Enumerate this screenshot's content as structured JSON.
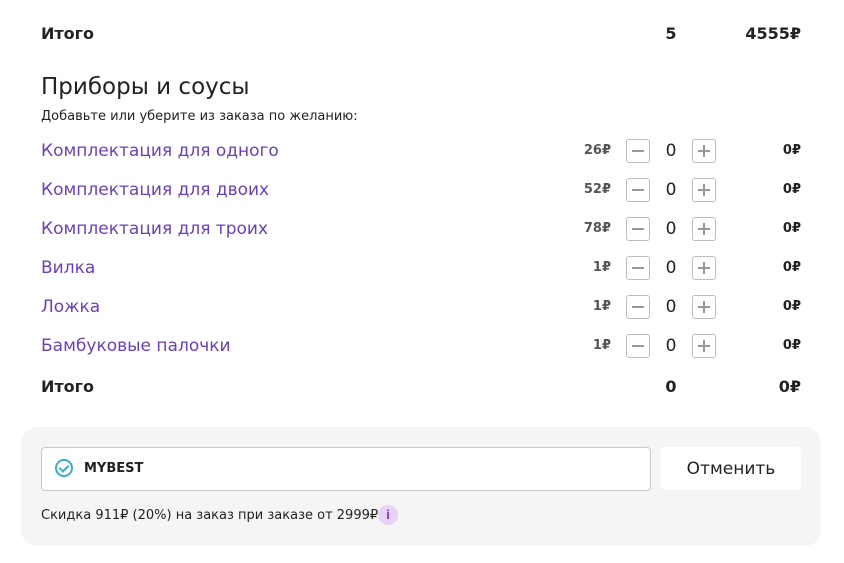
{
  "order_total": {
    "label": "Итого",
    "qty": "5",
    "sum": "4555₽"
  },
  "section": {
    "title": "Приборы и соусы",
    "subtitle": "Добавьте или уберите из заказа по желанию:"
  },
  "items": [
    {
      "name": "Комплектация для одного",
      "price": "26₽",
      "qty": "0",
      "sum": "0₽"
    },
    {
      "name": "Комплектация для двоих",
      "price": "52₽",
      "qty": "0",
      "sum": "0₽"
    },
    {
      "name": "Комплектация для троих",
      "price": "78₽",
      "qty": "0",
      "sum": "0₽"
    },
    {
      "name": "Вилка",
      "price": "1₽",
      "qty": "0",
      "sum": "0₽"
    },
    {
      "name": "Ложка",
      "price": "1₽",
      "qty": "0",
      "sum": "0₽"
    },
    {
      "name": "Бамбуковые палочки",
      "price": "1₽",
      "qty": "0",
      "sum": "0₽"
    }
  ],
  "items_total": {
    "label": "Итого",
    "qty": "0",
    "sum": "0₽"
  },
  "promo": {
    "code": "MYBEST",
    "cancel_label": "Отменить",
    "discount_text": "Скидка 911₽ (20%) на заказ при заказе от 2999₽",
    "info_glyph": "i"
  },
  "colors": {
    "accent_link": "#6a3fbf",
    "check_icon": "#3aaec6",
    "info_badge_bg": "#e8d2f7",
    "panel_bg": "#f5f5f5"
  },
  "icons": {
    "minus": "minus-icon",
    "plus": "plus-icon",
    "check": "check-circle-icon",
    "info": "info-icon"
  }
}
